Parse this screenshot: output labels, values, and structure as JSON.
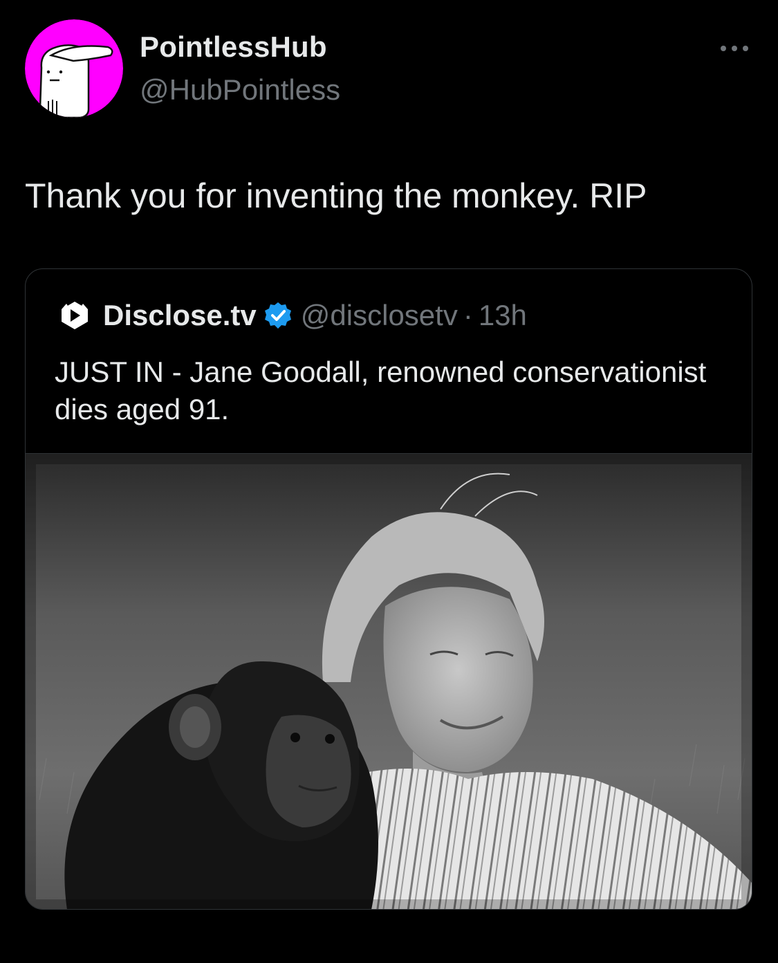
{
  "post": {
    "author": {
      "display_name": "PointlessHub",
      "handle": "@HubPointless",
      "avatar_icon": "cartoon-cap-character-avatar",
      "avatar_color": "#ff00ff"
    },
    "more_icon": "more-horizontal-icon",
    "text": "Thank you for inventing the monkey. RIP"
  },
  "quote": {
    "author": {
      "logo_icon": "disclose-tv-logo-icon",
      "display_name": "Disclose.tv",
      "verified_icon": "verified-badge-icon",
      "verified_color": "#1d9bf0",
      "handle": "@disclosetv",
      "separator": "·",
      "time": "13h"
    },
    "text": "JUST IN - Jane Goodall, renowned conservationist dies aged 91.",
    "media": {
      "type": "photo",
      "tone": "black-and-white"
    }
  },
  "colors": {
    "background": "#000000",
    "text_primary": "#e7e9ea",
    "text_secondary": "#71767b",
    "border": "#2f3336"
  }
}
